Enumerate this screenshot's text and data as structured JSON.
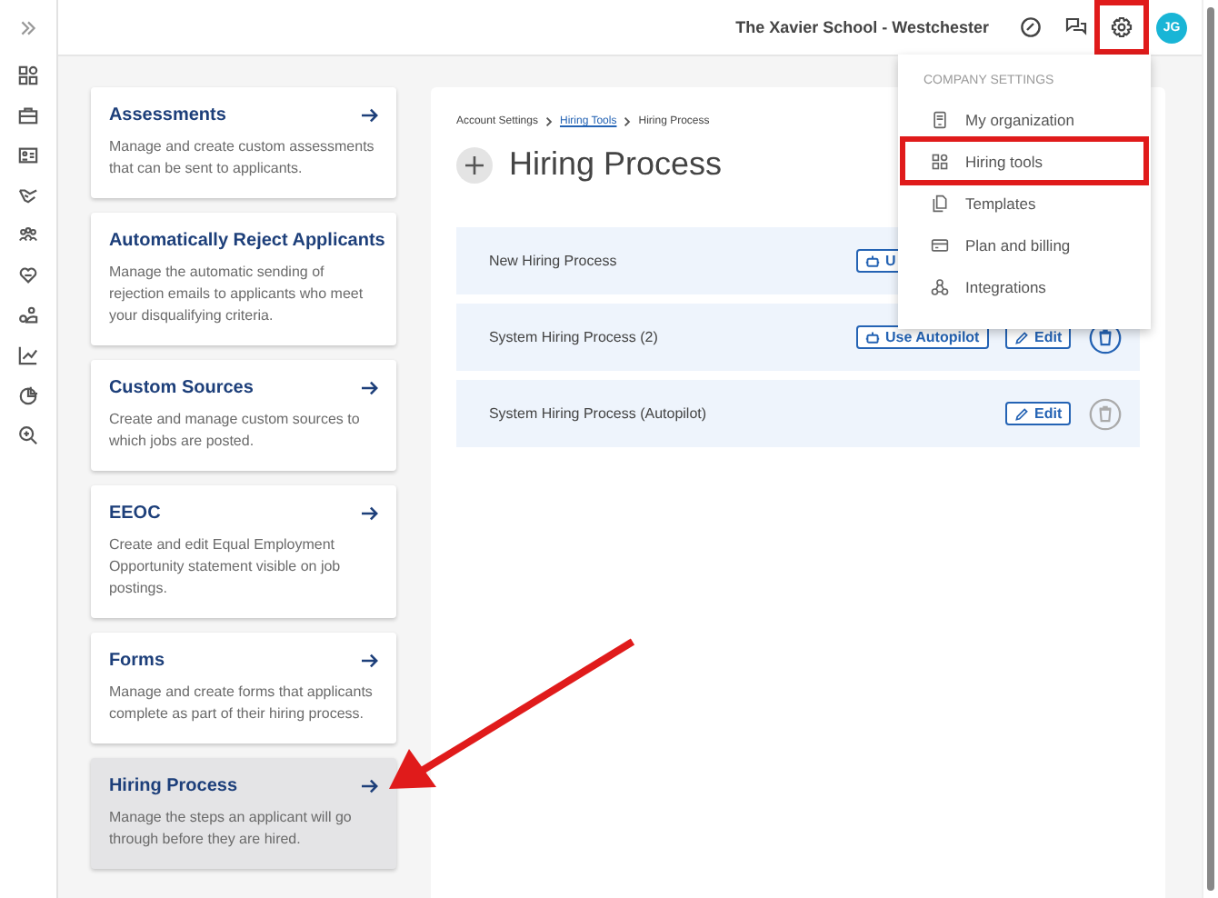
{
  "topbar": {
    "org_name": "The Xavier School - Westchester",
    "avatar_initials": "JG",
    "settings_highlighted": true
  },
  "cards": [
    {
      "title": "Assessments",
      "description": "Manage and create custom assessments that can be sent to applicants.",
      "selected": false
    },
    {
      "title": "Automatically Reject Applicants",
      "description": "Manage the automatic sending of rejection emails to applicants who meet your disqualifying criteria.",
      "selected": false
    },
    {
      "title": "Custom Sources",
      "description": "Create and manage custom sources to which jobs are posted.",
      "selected": false
    },
    {
      "title": "EEOC",
      "description": "Create and edit Equal Employment Opportunity statement visible on job postings.",
      "selected": false
    },
    {
      "title": "Forms",
      "description": "Manage and create forms that applicants complete as part of their hiring process.",
      "selected": false
    },
    {
      "title": "Hiring Process",
      "description": "Manage the steps an applicant will go through before they are hired.",
      "selected": true
    }
  ],
  "breadcrumb": [
    {
      "label": "Account Settings",
      "link": false
    },
    {
      "label": "Hiring Tools",
      "link": true
    },
    {
      "label": "Hiring Process",
      "link": false
    }
  ],
  "page_title": "Hiring Process",
  "processes": [
    {
      "name": "New Hiring Process",
      "autopilot_label": "U"
    },
    {
      "name": "System Hiring Process (2)",
      "autopilot_label": "Use Autopilot",
      "edit_label": "Edit",
      "delete_disabled": false
    },
    {
      "name": "System Hiring Process (Autopilot)",
      "edit_label": "Edit",
      "delete_disabled": true
    }
  ],
  "menu": {
    "heading": "COMPANY SETTINGS",
    "items": [
      {
        "label": "My organization",
        "selected": false
      },
      {
        "label": "Hiring tools",
        "selected": true
      },
      {
        "label": "Templates",
        "selected": false
      },
      {
        "label": "Plan and billing",
        "selected": false
      },
      {
        "label": "Integrations",
        "selected": false
      }
    ]
  },
  "annotation_arrow": true
}
